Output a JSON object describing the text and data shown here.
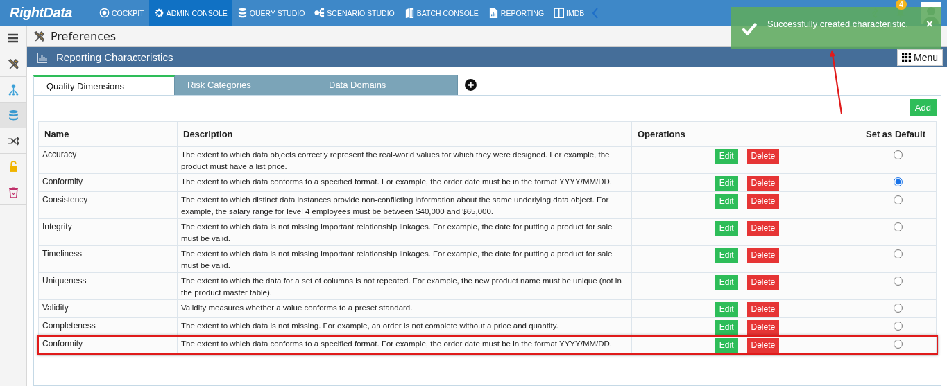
{
  "app": {
    "logo": "RightData",
    "notification_count": "4"
  },
  "nav": [
    {
      "label": "COCKPIT",
      "selected": false
    },
    {
      "label": "ADMIN CONSOLE",
      "selected": true
    },
    {
      "label": "QUERY STUDIO",
      "selected": false
    },
    {
      "label": "SCENARIO STUDIO",
      "selected": false
    },
    {
      "label": "BATCH CONSOLE",
      "selected": false
    },
    {
      "label": "REPORTING",
      "selected": false
    },
    {
      "label": "IMDB",
      "selected": false
    }
  ],
  "sidebar": {
    "items": [
      {
        "selected": false
      },
      {
        "selected": false
      },
      {
        "selected": true
      },
      {
        "selected": false
      },
      {
        "selected": false
      },
      {
        "selected": false
      }
    ]
  },
  "page_title": "Preferences",
  "section": {
    "title": "Reporting Characteristics",
    "menu_button": "Menu"
  },
  "tabs": [
    {
      "label": "Quality Dimensions",
      "selected": true
    },
    {
      "label": "Risk Categories",
      "selected": false
    },
    {
      "label": "Data Domains",
      "selected": false
    }
  ],
  "add_button": "Add",
  "table": {
    "columns": [
      "Name",
      "Description",
      "Operations",
      "Set as Default"
    ],
    "rows": [
      {
        "name": "Accuracy",
        "description": "The extent to which data objects correctly represent the real-world values for which they were designed. For example, the product must have a list price.",
        "edit": "Edit",
        "delete": "Delete",
        "selected": false,
        "highlighted": false
      },
      {
        "name": "Conformity",
        "description": "The extent to which data conforms to a specified format. For example, the order date must be in the format YYYY/MM/DD.",
        "edit": "Edit",
        "delete": "Delete",
        "selected": true,
        "highlighted": false
      },
      {
        "name": "Consistency",
        "description": "The extent to which distinct data instances provide non-conflicting information about the same underlying data object. For example, the salary range for level 4 employees must be between $40,000 and $65,000.",
        "edit": "Edit",
        "delete": "Delete",
        "selected": false,
        "highlighted": false
      },
      {
        "name": "Integrity",
        "description": "The extent to which data is not missing important relationship linkages. For example, the date for putting a product for sale must be valid.",
        "edit": "Edit",
        "delete": "Delete",
        "selected": false,
        "highlighted": false
      },
      {
        "name": "Timeliness",
        "description": "The extent to which data is not missing important relationship linkages. For example, the date for putting a product for sale must be valid.",
        "edit": "Edit",
        "delete": "Delete",
        "selected": false,
        "highlighted": false
      },
      {
        "name": "Uniqueness",
        "description": "The extent to which the data for a set of columns is not repeated. For example, the new product name must be unique (not in the product master table).",
        "edit": "Edit",
        "delete": "Delete",
        "selected": false,
        "highlighted": false
      },
      {
        "name": "Validity",
        "description": "Validity measures whether a value conforms to a preset standard.",
        "edit": "Edit",
        "delete": "Delete",
        "selected": false,
        "highlighted": false
      },
      {
        "name": "Completeness",
        "description": "The extent to which data is not missing. For example, an order is not complete without a price and quantity.",
        "edit": "Edit",
        "delete": "Delete",
        "selected": false,
        "highlighted": false
      },
      {
        "name": "Conformity",
        "description": "The extent to which data conforms to a specified format. For example, the order date must be in the format YYYY/MM/DD.",
        "edit": "Edit",
        "delete": "Delete",
        "selected": false,
        "highlighted": true
      }
    ]
  },
  "toast": {
    "kind": "success",
    "message": "Successfully created characteristic.",
    "close": "×"
  }
}
